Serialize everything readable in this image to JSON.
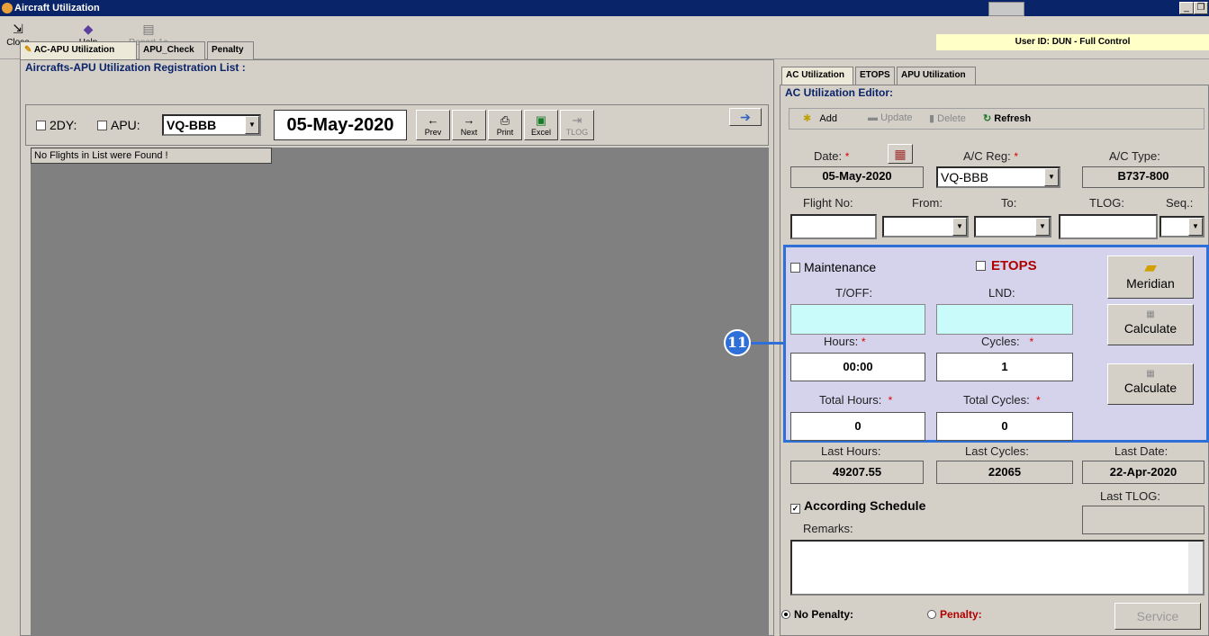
{
  "window": {
    "title": "Aircraft Utilization",
    "min": "_",
    "restore": "❐"
  },
  "toolbar": {
    "close_label": "Close",
    "help_label": "Help",
    "report_label": "Report 1a",
    "user_id": "User ID: DUN - Full Control"
  },
  "left_tabs": [
    "AC-APU Utilization",
    "APU_Check",
    "Penalty"
  ],
  "left": {
    "group_title": "Aircrafts-APU Utilization Registration List :",
    "chk_2dy": "2DY:",
    "chk_apu": "APU:",
    "apu_reg": "VQ-BBB",
    "date": "05-May-2020",
    "prev": "Prev",
    "next": "Next",
    "print": "Print",
    "excel": "Excel",
    "tlog": "TLOG",
    "status": "No Flights in List were Found !"
  },
  "right_tabs": [
    "AC Utilization",
    "ETOPS",
    "APU Utilization"
  ],
  "editor": {
    "group_title": "AC Utilization Editor:",
    "add": "Add",
    "update": "Update",
    "delete": "Delete",
    "refresh": "Refresh",
    "date_label": "Date:",
    "date_value": "05-May-2020",
    "acreg_label": "A/C Reg:",
    "acreg_value": "VQ-BBB",
    "actype_label": "A/C Type:",
    "actype_value": "B737-800",
    "flight_label": "Flight No:",
    "from_label": "From:",
    "to_label": "To:",
    "tlog_label": "TLOG:",
    "seq_label": "Seq.:",
    "maintenance": "Maintenance",
    "etops": "ETOPS",
    "toff_label": "T/OFF:",
    "lnd_label": "LND:",
    "meridian": "Meridian",
    "calculate1": "Calculate",
    "calculate2": "Calculate",
    "hours_label": "Hours:",
    "hours_value": "00:00",
    "cycles_label": "Cycles:",
    "cycles_value": "1",
    "total_hours_label": "Total Hours:",
    "total_hours_value": "0",
    "total_cycles_label": "Total Cycles:",
    "total_cycles_value": "0",
    "last_hours_label": "Last Hours:",
    "last_hours_value": "49207.55",
    "last_cycles_label": "Last Cycles:",
    "last_cycles_value": "22065",
    "last_date_label": "Last Date:",
    "last_date_value": "22-Apr-2020",
    "according_schedule": "According Schedule",
    "last_tlog_label": "Last TLOG:",
    "remarks_label": "Remarks:",
    "no_penalty": "No Penalty:",
    "penalty": "Penalty:",
    "service": "Service"
  },
  "callout": {
    "number": "11"
  },
  "colors": {
    "title_bg": "#0a246a",
    "callout": "#2f6fd8",
    "panel": "#d5d2ec",
    "cyan_input": "#c9fbfb",
    "list_bg": "#808080"
  }
}
